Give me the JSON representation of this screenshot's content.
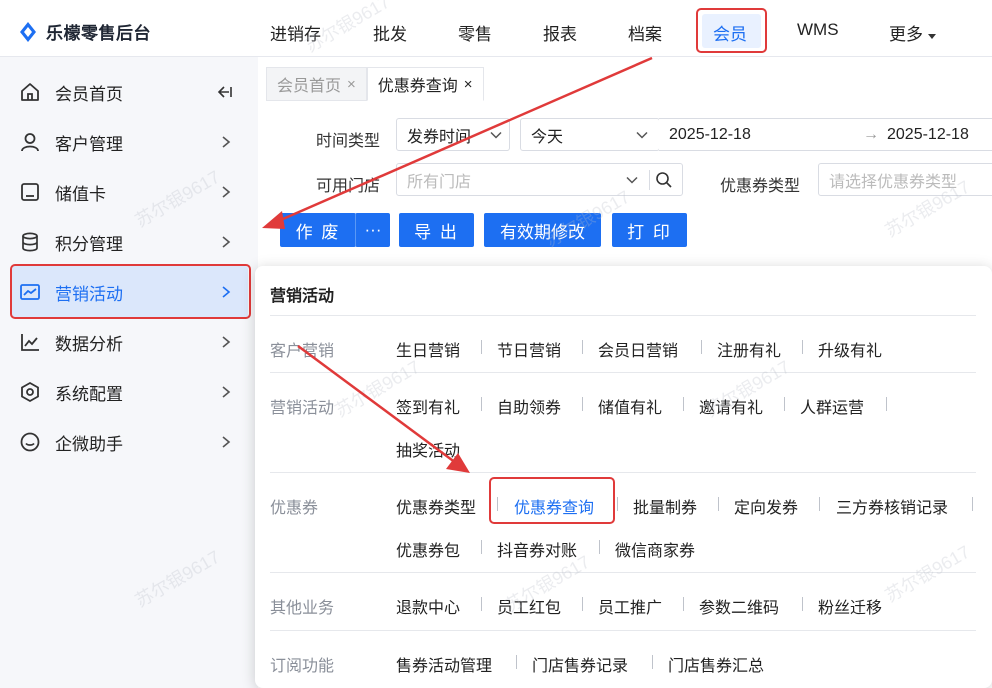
{
  "app": {
    "title": "乐檬零售后台"
  },
  "topnav": {
    "items": [
      "进销存",
      "批发",
      "零售",
      "报表",
      "档案",
      "会员",
      "WMS",
      "更多"
    ],
    "active": "会员"
  },
  "sidebar": {
    "items": [
      {
        "label": "会员首页",
        "icon": "home-icon"
      },
      {
        "label": "客户管理",
        "icon": "user-icon"
      },
      {
        "label": "储值卡",
        "icon": "card-icon"
      },
      {
        "label": "积分管理",
        "icon": "database-icon"
      },
      {
        "label": "营销活动",
        "icon": "monitor-chart-icon",
        "active": true
      },
      {
        "label": "数据分析",
        "icon": "line-chart-icon"
      },
      {
        "label": "系统配置",
        "icon": "hexagon-settings-icon"
      },
      {
        "label": "企微助手",
        "icon": "chat-bubble-icon"
      }
    ]
  },
  "tabs": [
    {
      "label": "会员首页",
      "close": "×"
    },
    {
      "label": "优惠券查询",
      "close": "×"
    }
  ],
  "filters": {
    "time_type_label": "时间类型",
    "time_type_value": "发券时间",
    "date_range_value": "今天",
    "date_start": "2025-12-18",
    "date_arrow": "→",
    "date_end": "2025-12-18",
    "store_label": "可用门店",
    "store_placeholder": "所有门店",
    "coupon_type_label": "优惠券类型",
    "coupon_type_placeholder": "请选择优惠券类型"
  },
  "toolbar": {
    "void": "作 废",
    "more": "···",
    "export": "导 出",
    "validity": "有效期修改",
    "print": "打 印"
  },
  "popup": {
    "title": "营销活动",
    "sections": [
      {
        "category": "客户营销",
        "rows": [
          [
            "生日营销",
            "节日营销",
            "会员日营销",
            "注册有礼",
            "升级有礼"
          ]
        ]
      },
      {
        "category": "营销活动",
        "rows": [
          [
            "签到有礼",
            "自助领券",
            "储值有礼",
            "邀请有礼",
            "人群运营"
          ],
          [
            "抽奖活动"
          ]
        ]
      },
      {
        "category": "优惠券",
        "rows": [
          [
            "优惠券类型",
            "优惠券查询",
            "批量制券",
            "定向发券",
            "三方券核销记录"
          ],
          [
            "优惠券包",
            "抖音券对账",
            "微信商家券"
          ]
        ]
      },
      {
        "category": "其他业务",
        "rows": [
          [
            "退款中心",
            "员工红包",
            "员工推广",
            "参数二维码",
            "粉丝迁移"
          ]
        ]
      },
      {
        "category": "订阅功能",
        "rows": [
          [
            "售券活动管理",
            "门店售券记录",
            "门店售券汇总"
          ]
        ]
      }
    ]
  },
  "watermark": "苏尔银9617",
  "colors": {
    "accent": "#1d6ff2",
    "annotation": "#e03a3a"
  }
}
